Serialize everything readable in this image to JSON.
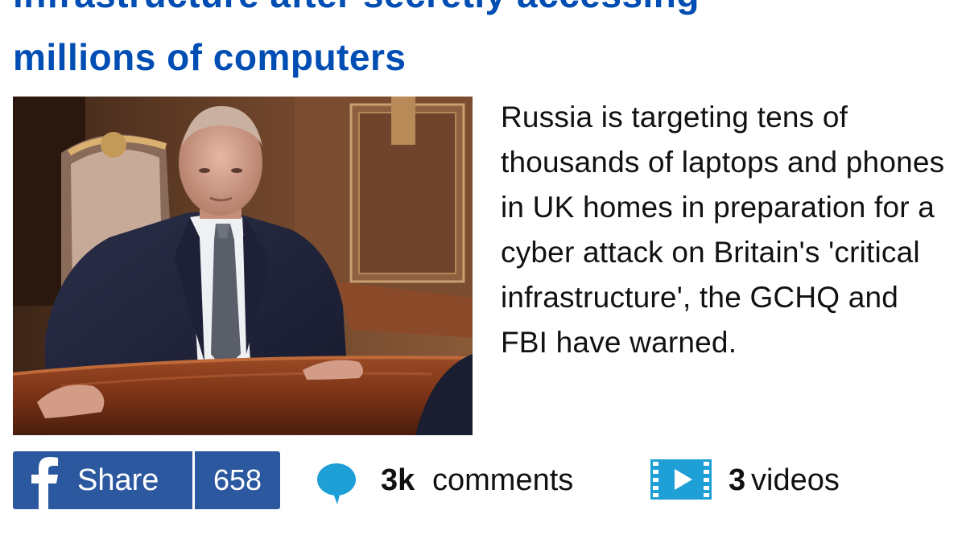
{
  "article": {
    "headline_line1": "infrastructure after secretly accessing",
    "headline_line2": "millions of computers",
    "summary": "Russia is targeting tens of thousands of laptops and phones in UK homes in preparation for a cyber attack on Britain's 'critical infrastructure', the GCHQ and FBI have warned.",
    "image_icon": "photo"
  },
  "share": {
    "label": "Share",
    "count": "658",
    "icon": "facebook-icon"
  },
  "comments": {
    "count": "3k",
    "label": "comments",
    "icon": "speech-bubble-icon"
  },
  "videos": {
    "count": "3",
    "label": "videos",
    "icon": "play-video-icon"
  },
  "colors": {
    "headline": "#004db3",
    "facebook_blue": "#2c58a0",
    "comment_icon": "#1e9fd6",
    "video_icon": "#1e9fd6"
  }
}
